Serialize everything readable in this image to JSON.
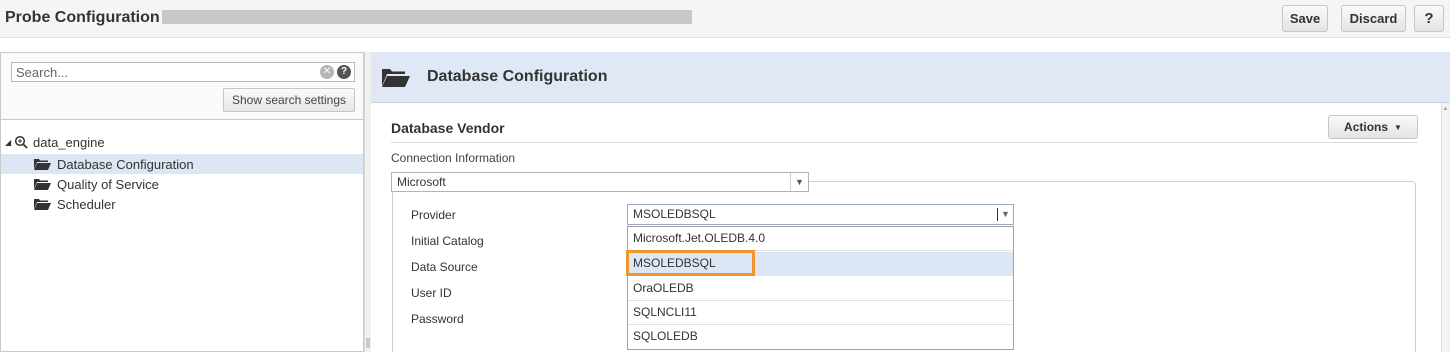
{
  "window": {
    "title": "Probe Configuration",
    "save_label": "Save",
    "discard_label": "Discard",
    "help_label": "?"
  },
  "search": {
    "placeholder": "Search...",
    "settings_button": "Show search settings"
  },
  "tree": {
    "root": "data_engine",
    "items": [
      {
        "label": "Database Configuration",
        "selected": true
      },
      {
        "label": "Quality of Service",
        "selected": false
      },
      {
        "label": "Scheduler",
        "selected": false
      }
    ]
  },
  "panel": {
    "title": "Database Configuration",
    "section_title": "Database Vendor",
    "actions_label": "Actions",
    "connection_label": "Connection Information",
    "vendor_value": "Microsoft"
  },
  "form": {
    "labels": [
      "Provider",
      "Initial Catalog",
      "Data Source",
      "User ID",
      "Password"
    ],
    "provider_value": "MSOLEDBSQL",
    "provider_options": [
      "Microsoft.Jet.OLEDB.4.0",
      "MSOLEDBSQL",
      "OraOLEDB",
      "SQLNCLI11",
      "SQLOLEDB"
    ],
    "hovered_option": "MSOLEDBSQL"
  },
  "colors": {
    "header_bg": "#dfe8f4",
    "selection_bg": "#dce6f4",
    "highlight": "#f0962e"
  },
  "icons": [
    "search-clear-icon",
    "help-icon",
    "probe-icon",
    "folder-icon",
    "chevron-down-icon"
  ]
}
